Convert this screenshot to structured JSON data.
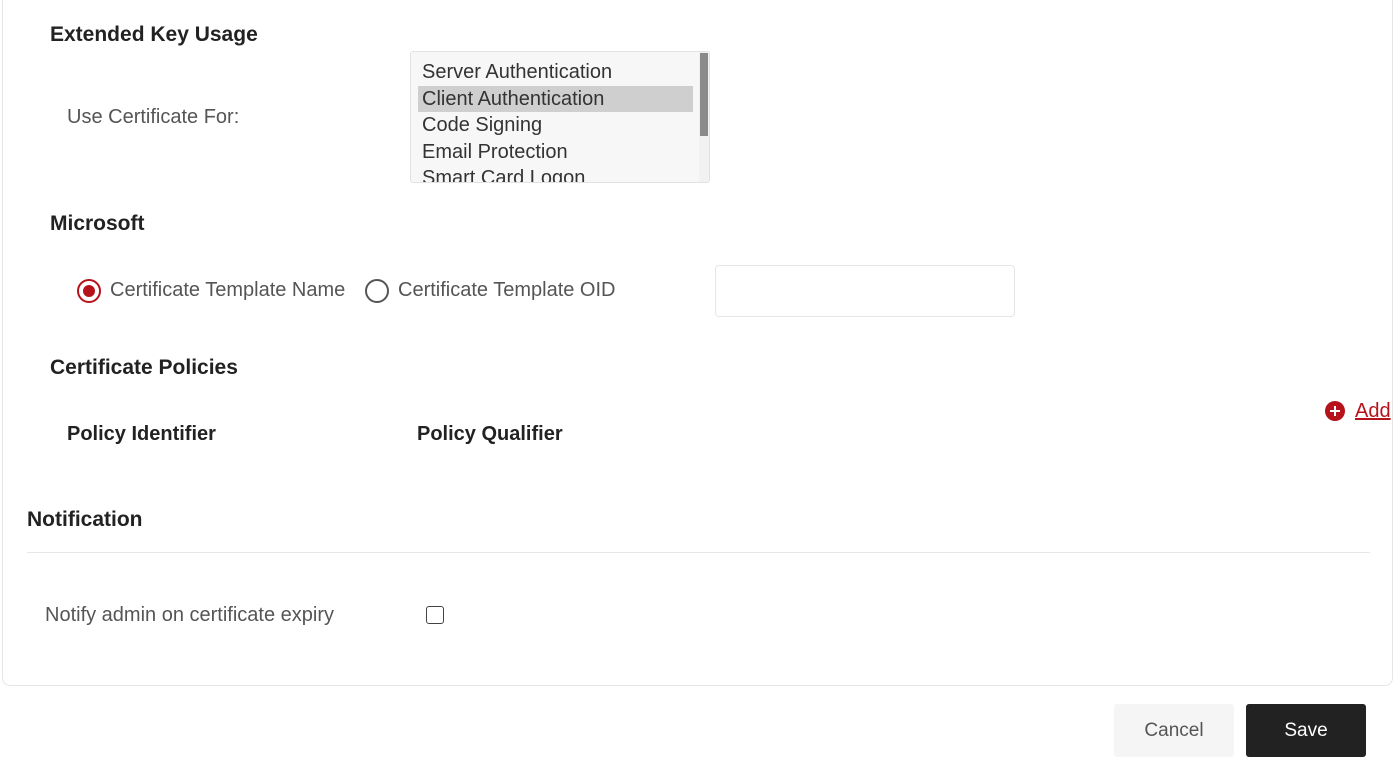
{
  "extended_key_usage": {
    "title": "Extended Key Usage",
    "use_for_label": "Use Certificate For:",
    "options": [
      {
        "label": "Server Authentication",
        "selected": false
      },
      {
        "label": "Client Authentication",
        "selected": true
      },
      {
        "label": "Code Signing",
        "selected": false
      },
      {
        "label": "Email Protection",
        "selected": false
      },
      {
        "label": "Smart Card Logon",
        "selected": false
      }
    ]
  },
  "microsoft": {
    "title": "Microsoft",
    "radio_name_label": "Certificate Template Name",
    "radio_oid_label": "Certificate Template OID",
    "selected_option": "Certificate Template Name",
    "template_value": ""
  },
  "certificate_policies": {
    "title": "Certificate Policies",
    "col_identifier": "Policy Identifier",
    "col_qualifier": "Policy Qualifier",
    "add_label": "Add"
  },
  "notification": {
    "title": "Notification",
    "notify_label": "Notify admin on certificate expiry",
    "notify_checked": false
  },
  "footer": {
    "cancel_label": "Cancel",
    "save_label": "Save"
  },
  "colors": {
    "accent": "#b5121b",
    "primary_button": "#222222"
  }
}
